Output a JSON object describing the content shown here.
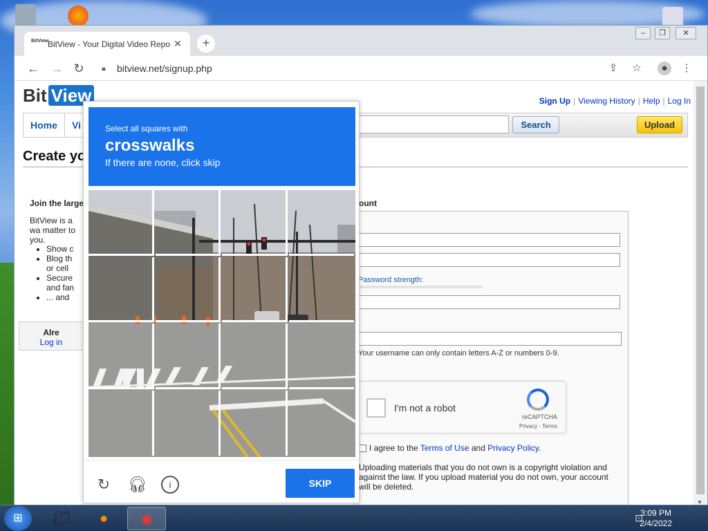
{
  "browser": {
    "tab_title": "BitView - Your Digital Video Repo",
    "favicon_text": "BitView",
    "url": "bitview.net/signup.php"
  },
  "site": {
    "logo_bit": "Bit",
    "logo_view": "View",
    "top_links": [
      "Sign Up",
      "Viewing History",
      "Help",
      "Log In"
    ],
    "nav": [
      "Home",
      "Vi"
    ],
    "search_label": "Search",
    "upload_label": "Upload",
    "heading": "Create yo",
    "join_text": "Join the large",
    "intro": "BitView is a wa matter to you.",
    "bullets": [
      "Show c",
      "Blog th",
      "or cell",
      "Secure",
      "and fan",
      "... and"
    ],
    "left_box_text": "Alre",
    "left_box_link": "Log in",
    "account_heading": "ount",
    "password_strength": "Password strength:",
    "username_note": "Your username can only contain letters A-Z or numbers 0-9.",
    "recaptcha_label": "I'm not a robot",
    "recaptcha_brand": "reCAPTCHA",
    "recaptcha_links": "Privacy - Terms",
    "agree_prefix": "I agree to the",
    "terms_link": "Terms of Use",
    "and_text": "and",
    "privacy_link": "Privacy Policy",
    "period": ".",
    "warning": "Uploading materials that you do not own is a copyright violation and against the law. If you upload material you do not own, your account will be deleted."
  },
  "captcha": {
    "instruction": "Select all squares with",
    "target": "crosswalks",
    "hint": "If there are none, click skip",
    "skip_label": "SKIP",
    "accent": "#1a73e8"
  },
  "taskbar": {
    "time": "3:09 PM",
    "date": "2/4/2022"
  }
}
